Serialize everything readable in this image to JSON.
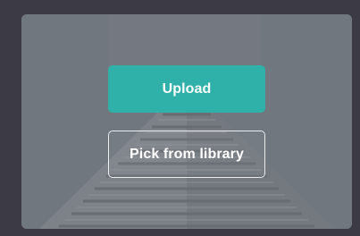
{
  "card": {
    "background_image": "building-photo",
    "actions": {
      "upload_label": "Upload",
      "library_label": "Pick from library"
    }
  },
  "colors": {
    "page_background": "#3b3a45",
    "upload_button": "#2fb0a8",
    "button_text": "#ffffff"
  }
}
